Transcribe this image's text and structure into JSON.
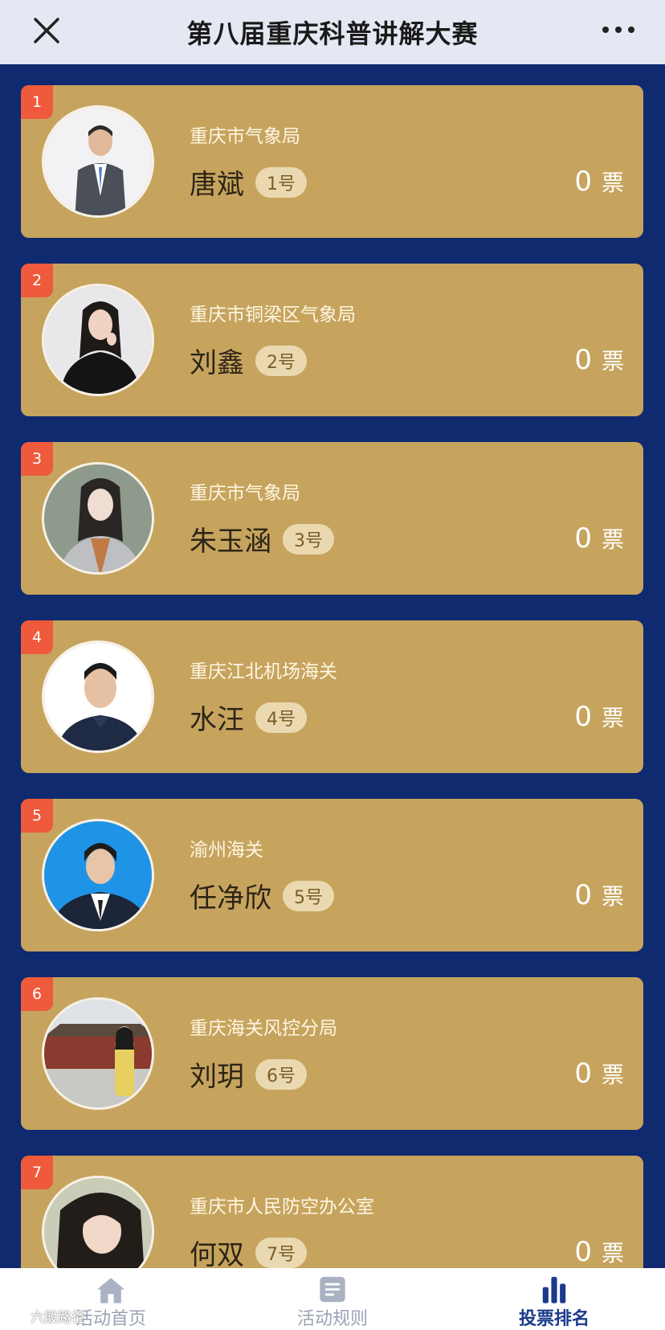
{
  "header": {
    "title": "第八届重庆科普讲解大赛",
    "close_icon": "close-icon",
    "more_icon": "more-dots-icon"
  },
  "votes_unit": "票",
  "contestants": [
    {
      "rank": "1",
      "org": "重庆市气象局",
      "name": "唐斌",
      "number": "1号",
      "votes": "0"
    },
    {
      "rank": "2",
      "org": "重庆市铜梁区气象局",
      "name": "刘鑫",
      "number": "2号",
      "votes": "0"
    },
    {
      "rank": "3",
      "org": "重庆市气象局",
      "name": "朱玉涵",
      "number": "3号",
      "votes": "0"
    },
    {
      "rank": "4",
      "org": "重庆江北机场海关",
      "name": "水汪",
      "number": "4号",
      "votes": "0"
    },
    {
      "rank": "5",
      "org": "渝州海关",
      "name": "任净欣",
      "number": "5号",
      "votes": "0"
    },
    {
      "rank": "6",
      "org": "重庆海关风控分局",
      "name": "刘玥",
      "number": "6号",
      "votes": "0"
    },
    {
      "rank": "7",
      "org": "重庆市人民防空办公室",
      "name": "何双",
      "number": "7号",
      "votes": "0"
    }
  ],
  "tabbar": {
    "tabs": [
      {
        "label": "活动首页",
        "icon": "home-icon"
      },
      {
        "label": "活动规则",
        "icon": "document-icon"
      },
      {
        "label": "投票排名",
        "icon": "bar-chart-icon",
        "active": true
      }
    ]
  },
  "watermark": "六殷路径",
  "colors": {
    "background": "#0f2a6e",
    "card": "#c6a45e",
    "rank_badge": "#ef5a3c",
    "active_tab": "#1c3a8c"
  }
}
